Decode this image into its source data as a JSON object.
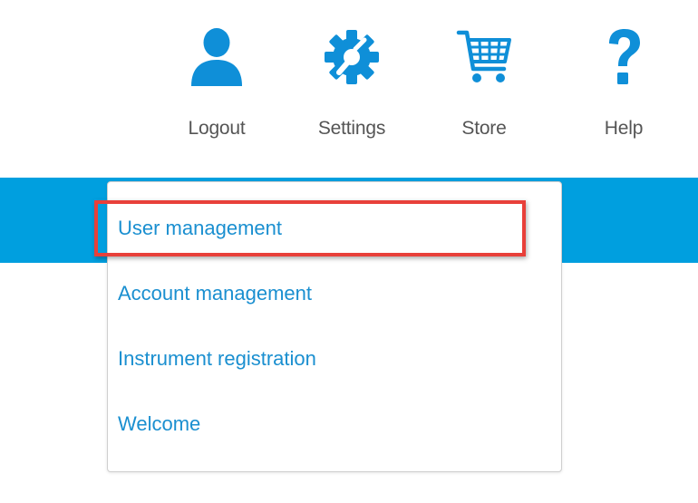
{
  "nav": {
    "logout": {
      "label": "Logout",
      "icon": "user-icon"
    },
    "settings": {
      "label": "Settings",
      "icon": "gear-wrench-icon"
    },
    "store": {
      "label": "Store",
      "icon": "shopping-cart-icon"
    },
    "help": {
      "label": "Help",
      "icon": "question-mark-icon"
    }
  },
  "menu": {
    "items": [
      {
        "label": "User management",
        "highlighted": true
      },
      {
        "label": "Account management",
        "highlighted": false
      },
      {
        "label": "Instrument registration",
        "highlighted": false
      },
      {
        "label": "Welcome",
        "highlighted": false
      }
    ]
  },
  "colors": {
    "icon_blue": "#0f8fd8",
    "band_blue": "#009fdf",
    "link_blue": "#1a8fd0",
    "highlight_red": "#e8403a",
    "label_gray": "#555555"
  }
}
